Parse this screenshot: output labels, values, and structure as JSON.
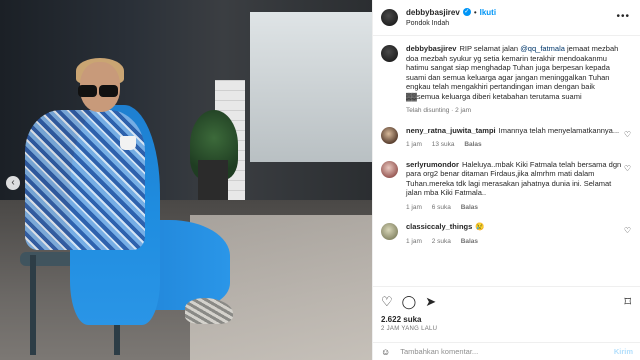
{
  "post": {
    "username": "debbybasjirev",
    "follow_label": "Ikuti",
    "location": "Pondok Indah",
    "caption_user": "debbybasjirev",
    "caption_prefix": "RIP selamat jalan ",
    "caption_mention": "@qq_fatmala",
    "caption_rest": " jemaat mezbah doa mezbah syukur yg setia kemarin terakhir mendoakanmu hatimu sangat siap menghadap Tuhan juga berpesan kepada suami dan semua keluarga agar jangan meninggalkan Tuhan engkau telah mengakhiri pertandingan iman dengan baik ▓▓semua keluarga diberi ketabahan terutama suami",
    "caption_meta": "Telah disunting · 2 jam",
    "likes": "2.622 suka",
    "time_ago": "2 JAM YANG LALU"
  },
  "comments": [
    {
      "user": "neny_ratna_juwita_tampi",
      "text": "Imannya telah menyelamatkannya...",
      "time": "1 jam",
      "likes": "13 suka",
      "reply": "Balas"
    },
    {
      "user": "serlyrumondor",
      "text": "Haleluya..mbak Kiki Fatmala telah bersama dgn para org2 benar ditaman Firdaus,jika almrhm mati dalam Tuhan.mereka tdk lagi merasakan jahatnya dunia ini. Selamat jalan mba Kiki Fatmala..",
      "time": "1 jam",
      "likes": "6 suka",
      "reply": "Balas"
    },
    {
      "user": "classiccaly_things",
      "text": "😢",
      "time": "1 jam",
      "likes": "2 suka",
      "reply": "Balas"
    }
  ],
  "add_comment": {
    "placeholder": "Tambahkan komentar...",
    "post_label": "Kirim"
  },
  "icons": {
    "heart": "heart-icon",
    "comment": "comment-icon",
    "share": "share-icon",
    "bookmark": "bookmark-icon",
    "more": "more-icon",
    "emoji": "emoji-icon",
    "verified": "verified-badge-icon",
    "prev": "chevron-left-icon"
  },
  "colors": {
    "link": "#0095f6",
    "text": "#262626",
    "muted": "#737373",
    "border": "#efefef"
  }
}
